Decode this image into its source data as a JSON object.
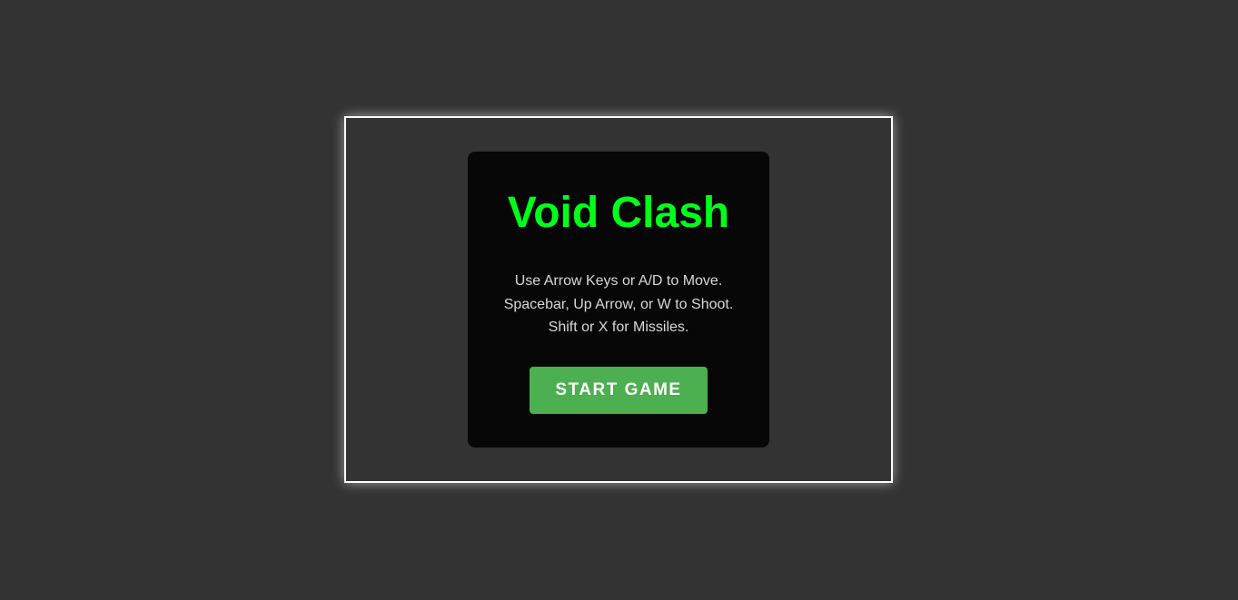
{
  "game": {
    "title": "Void Clash",
    "instructions": [
      "Use Arrow Keys or A/D to Move.",
      "Spacebar, Up Arrow, or W to Shoot.",
      "Shift or X for Missiles."
    ],
    "start_button_label": "START GAME"
  },
  "colors": {
    "background": "#333333",
    "panel": "#070707",
    "title": "#00ff1a",
    "button": "#4caf50",
    "frame_border": "#ffffff"
  }
}
